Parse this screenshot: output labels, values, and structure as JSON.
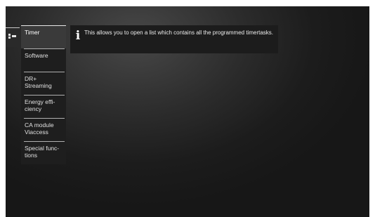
{
  "side_tab": {
    "icon": "list-grid-icon"
  },
  "menu": {
    "items": [
      {
        "label": "Timer",
        "selected": true
      },
      {
        "label": "Software",
        "selected": false
      },
      {
        "label": "DR+ Streaming",
        "selected": false
      },
      {
        "label": "Energy effi-ciency",
        "selected": false
      },
      {
        "label": "CA module Viaccess",
        "selected": false
      },
      {
        "label": "Special func-tions",
        "selected": false
      }
    ]
  },
  "info": {
    "icon": "info-icon",
    "text": "This allows you to open a list which contains all the programmed timertasks."
  },
  "colors": {
    "background": "#1c1c1c",
    "panel": "#1e1e1e",
    "selected": "#3a3a3a",
    "text": "#e0e0e0"
  }
}
